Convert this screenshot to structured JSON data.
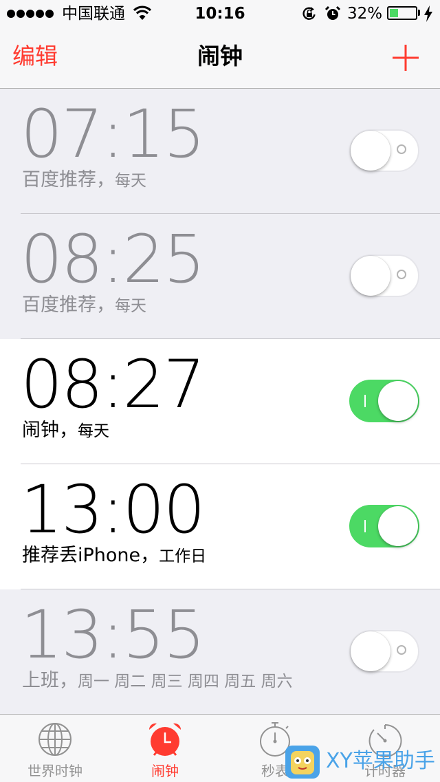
{
  "status_bar": {
    "signal_dots": 5,
    "carrier": "中国联通",
    "time": "10:16",
    "battery_percent_text": "32%",
    "battery_level": 0.32,
    "icons": [
      "wifi-icon",
      "rotation-lock-icon",
      "alarm-icon",
      "charging-icon"
    ]
  },
  "nav": {
    "edit_label": "编辑",
    "title": "闹钟",
    "add_icon": "plus-icon"
  },
  "alarms": [
    {
      "time": "07:15",
      "label": "百度推荐，",
      "repeat": "每天",
      "enabled": false
    },
    {
      "time": "08:25",
      "label": "百度推荐，",
      "repeat": "每天",
      "enabled": false
    },
    {
      "time": "08:27",
      "label": "闹钟，",
      "repeat": "每天",
      "enabled": true
    },
    {
      "time": "13:00",
      "label": "推荐丢iPhone，",
      "repeat": "工作日",
      "enabled": true
    },
    {
      "time": "13:55",
      "label": "上班，",
      "repeat": "周一 周二 周三 周四 周五 周六",
      "enabled": false
    }
  ],
  "tabs": [
    {
      "label": "世界时钟",
      "icon": "globe-icon",
      "active": false
    },
    {
      "label": "闹钟",
      "icon": "alarm-clock-icon",
      "active": true
    },
    {
      "label": "秒表",
      "icon": "stopwatch-icon",
      "active": false
    },
    {
      "label": "计时器",
      "icon": "timer-icon",
      "active": false
    }
  ],
  "watermark": {
    "text": "XY苹果助手"
  },
  "colors": {
    "accent_red": "#ff3b30",
    "switch_green": "#4cd964",
    "inactive_gray": "#8e8e93",
    "watermark_blue": "#4aa3e8"
  }
}
